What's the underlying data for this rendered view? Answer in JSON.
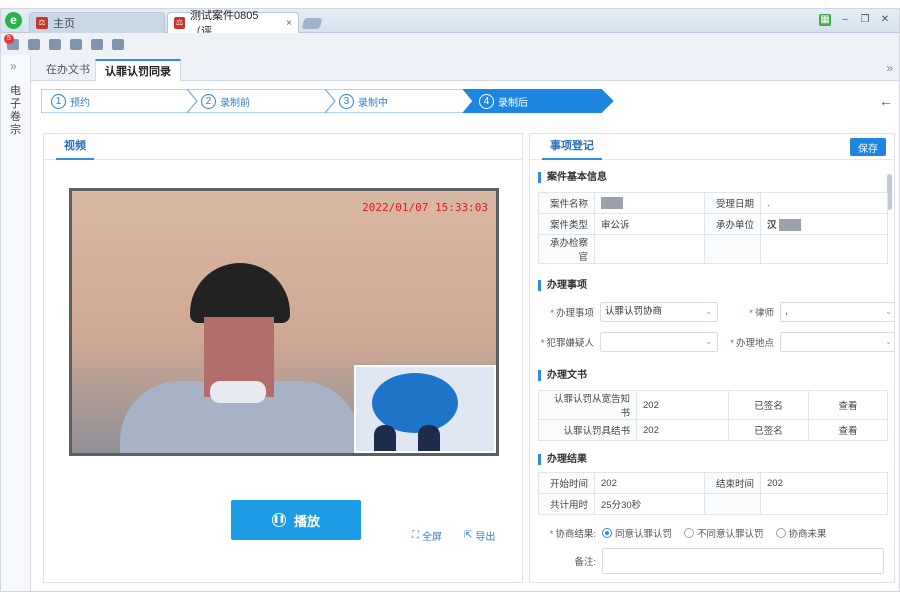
{
  "browser": {
    "logo": "e",
    "tabs": [
      {
        "label": "主页"
      },
      {
        "label": "测试案件0805（评...",
        "close": "×"
      }
    ],
    "window_controls": [
      "minimize",
      "restore",
      "close"
    ]
  },
  "toolbar": {
    "notification_count": "5"
  },
  "left_strip": {
    "toggle": "»",
    "title": "电子卷宗"
  },
  "subtabs": [
    {
      "label": "在办文书"
    },
    {
      "label": "认罪认罚同录"
    }
  ],
  "steps": [
    {
      "num": "1",
      "label": "预约"
    },
    {
      "num": "2",
      "label": "录制前"
    },
    {
      "num": "3",
      "label": "录制中"
    },
    {
      "num": "4",
      "label": "录制后"
    }
  ],
  "video_panel": {
    "title": "视频",
    "timestamp": "2022/01/07  15:33:03",
    "play_label": "播放",
    "fullscreen_label": "全屏",
    "export_label": "导出"
  },
  "matters": {
    "title": "事项登记",
    "save_label": "保存",
    "case_info": {
      "heading": "案件基本信息",
      "rows": [
        {
          "l1": "案件名称",
          "v1": "",
          "l2": "受理日期",
          "v2": "."
        },
        {
          "l1": "案件类型",
          "v1": "审公诉",
          "l2": "承办单位",
          "v2": "汉"
        },
        {
          "l1": "承办检察官",
          "v1": "",
          "l2": "",
          "v2": ""
        }
      ]
    },
    "handling": {
      "heading": "办理事项",
      "matter_label": "办理事项",
      "matter_value": "认罪认罚协商",
      "lawyer_label": "律师",
      "lawyer_value": ",",
      "suspect_label": "犯罪嫌疑人",
      "suspect_value": "",
      "place_label": "办理地点",
      "place_value": ""
    },
    "documents": {
      "heading": "办理文书",
      "rows": [
        {
          "name": "认罪认罚从宽告知书",
          "date": "202",
          "status": "已签名",
          "action": "查看"
        },
        {
          "name": "认罪认罚具结书",
          "date": "202",
          "status": "已签名",
          "action": "查看"
        }
      ]
    },
    "result": {
      "heading": "办理结果",
      "start_label": "开始时间",
      "start_value": "202",
      "end_label": "结束时间",
      "end_value": "202",
      "duration_label": "共计用时",
      "duration_value": "25分30秒",
      "outcome_label": "协商结果:",
      "options": [
        "同意认罪认罚",
        "不同意认罪认罚",
        "协商未果"
      ],
      "selected": 0,
      "remark_label": "备注:"
    }
  }
}
